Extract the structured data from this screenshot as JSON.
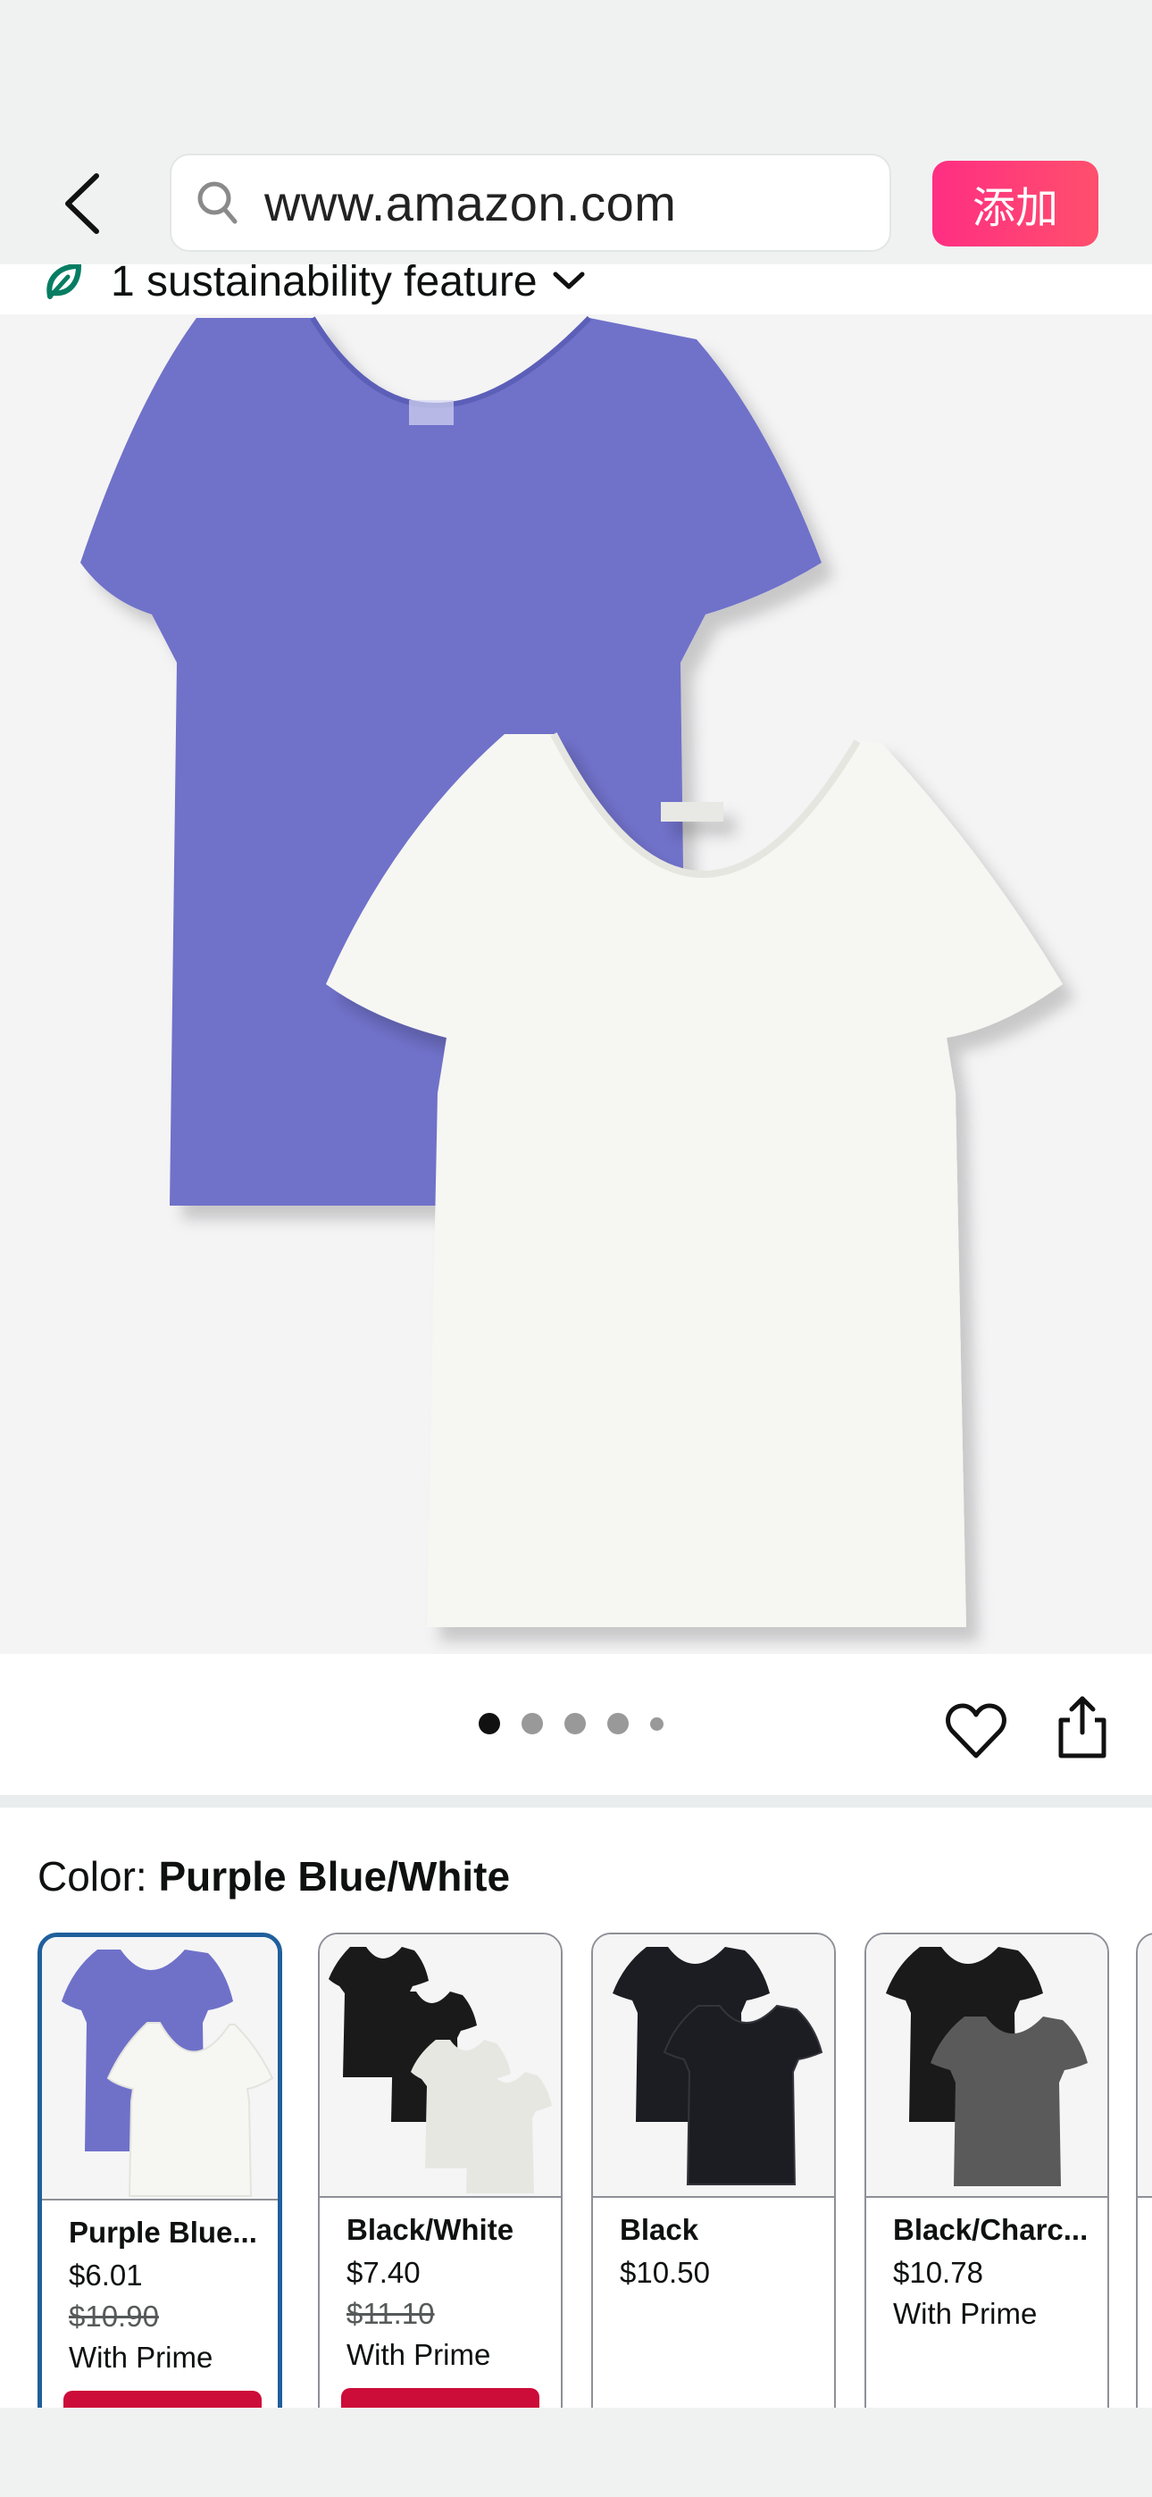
{
  "browser": {
    "url": "www.amazon.com",
    "add_button_label": "添加"
  },
  "sustainability": {
    "label": "1 sustainability feature"
  },
  "gallery": {
    "total_images": 5,
    "active_index": 0
  },
  "color": {
    "prefix": "Color: ",
    "selected_name": "Purple Blue/White"
  },
  "swatches": [
    {
      "name": "Purple Blue...",
      "price": "$6.01",
      "list_price": "$10.90",
      "prime": "With Prime",
      "shirt_colors": [
        "#6f71c9",
        "#f6f6f2"
      ]
    },
    {
      "name": "Black/White",
      "price": "$7.40",
      "list_price": "$11.10",
      "prime": "With Prime",
      "shirt_colors": [
        "#1a1a1a",
        "#1a1a1a",
        "#e7e7e2",
        "#e7e7e2"
      ]
    },
    {
      "name": "Black",
      "price": "$10.50",
      "shirt_colors": [
        "#1c1d22",
        "#1c1d22"
      ]
    },
    {
      "name": "Black/Charc...",
      "price": "$10.78",
      "prime": "With Prime",
      "shirt_colors": [
        "#1a1a1a",
        "#5a5a5a"
      ]
    }
  ],
  "colors": {
    "accent_pink": "#ff2e82",
    "selected_border": "#1f5f9c",
    "deal_red": "#cc0c39",
    "shirt_purple": "#6f71c9",
    "shirt_white": "#f6f6f2"
  }
}
